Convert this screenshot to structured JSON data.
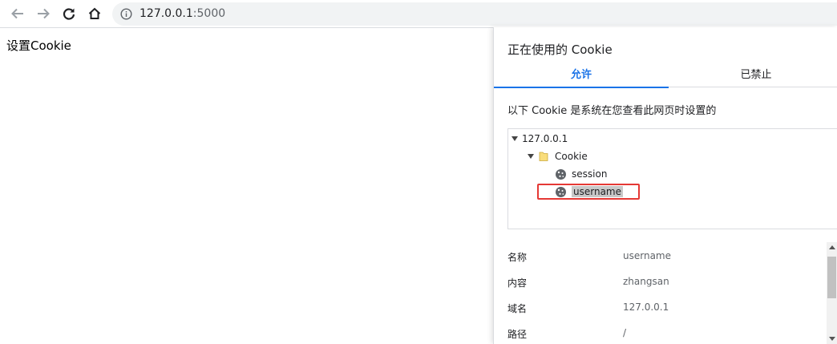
{
  "browser": {
    "url_host": "127.0.0.1",
    "url_port": ":5000"
  },
  "page": {
    "text": "设置Cookie"
  },
  "dialog": {
    "title": "正在使用的 Cookie",
    "tabs": [
      {
        "label": "允许",
        "active": true
      },
      {
        "label": "已禁止",
        "active": false
      }
    ],
    "description": "以下 Cookie 是系统在您查看此网页时设置的",
    "tree": {
      "site": "127.0.0.1",
      "folder": "Cookie",
      "cookies": [
        "session",
        "username"
      ],
      "selected": "username"
    },
    "properties": [
      {
        "key": "名称",
        "value": "username"
      },
      {
        "key": "内容",
        "value": "zhangsan"
      },
      {
        "key": "域名",
        "value": "127.0.0.1"
      },
      {
        "key": "路径",
        "value": "/"
      }
    ]
  },
  "colors": {
    "accent": "#1a73e8",
    "highlight": "#e53935",
    "selection": "#c8c8c8"
  },
  "icons": [
    "back-arrow-icon",
    "forward-arrow-icon",
    "reload-icon",
    "home-icon",
    "info-icon",
    "folder-icon",
    "cookie-icon"
  ]
}
